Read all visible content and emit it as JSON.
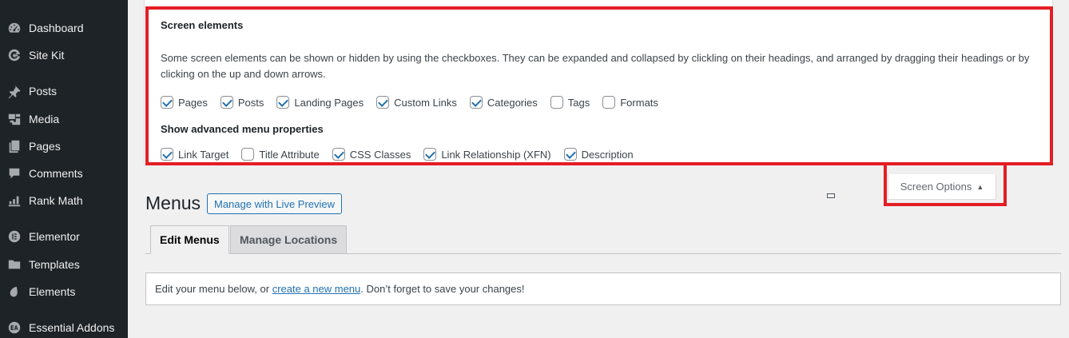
{
  "sidebar": {
    "items": [
      {
        "label": "Dashboard",
        "icon": "dashboard-icon"
      },
      {
        "label": "Site Kit",
        "icon": "sitekit-icon"
      },
      {
        "label": "Posts",
        "icon": "pin-icon"
      },
      {
        "label": "Media",
        "icon": "media-icon"
      },
      {
        "label": "Pages",
        "icon": "pages-icon"
      },
      {
        "label": "Comments",
        "icon": "comment-icon"
      },
      {
        "label": "Rank Math",
        "icon": "chart-icon"
      },
      {
        "label": "Elementor",
        "icon": "elementor-icon"
      },
      {
        "label": "Templates",
        "icon": "folder-icon"
      },
      {
        "label": "Elements",
        "icon": "elements-icon"
      },
      {
        "label": "Essential Addons",
        "icon": "essential-addons-icon"
      }
    ]
  },
  "screen_options": {
    "title": "Screen elements",
    "description": "Some screen elements can be shown or hidden by using the checkboxes. They can be expanded and collapsed by clickling on their headings, and arranged by dragging their headings or by clicking on the up and down arrows.",
    "elements": [
      {
        "label": "Pages",
        "checked": true
      },
      {
        "label": "Posts",
        "checked": true
      },
      {
        "label": "Landing Pages",
        "checked": true
      },
      {
        "label": "Custom Links",
        "checked": true
      },
      {
        "label": "Categories",
        "checked": true
      },
      {
        "label": "Tags",
        "checked": false
      },
      {
        "label": "Formats",
        "checked": false
      }
    ],
    "advanced_title": "Show advanced menu properties",
    "advanced": [
      {
        "label": "Link Target",
        "checked": true
      },
      {
        "label": "Title Attribute",
        "checked": false
      },
      {
        "label": "CSS Classes",
        "checked": true
      },
      {
        "label": "Link Relationship (XFN)",
        "checked": true
      },
      {
        "label": "Description",
        "checked": true
      }
    ],
    "tab_label": "Screen Options",
    "tab_arrow": "▲"
  },
  "main": {
    "title": "Menus",
    "live_preview_button": "Manage with Live Preview",
    "tabs": [
      {
        "label": "Edit Menus",
        "active": true
      },
      {
        "label": "Manage Locations",
        "active": false
      }
    ],
    "notice": {
      "before": "Edit your menu below, or ",
      "link": "create a new menu",
      "after": ". Don’t forget to save your changes!"
    }
  },
  "colors": {
    "sidebar_bg": "#1d2327",
    "accent": "#2271b1",
    "highlight": "#e31e24"
  }
}
